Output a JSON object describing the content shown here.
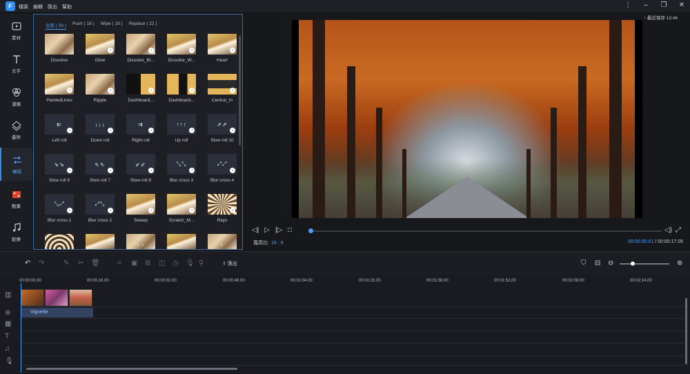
{
  "app": {
    "logo": "F",
    "menu": [
      "檔案",
      "編輯",
      "匯出",
      "幫助"
    ]
  },
  "window_controls": [
    "more-vertical",
    "minimize",
    "restore",
    "close"
  ],
  "rail": [
    {
      "label": "素材",
      "icon": "media-icon"
    },
    {
      "label": "文字",
      "icon": "text-icon"
    },
    {
      "label": "濾鏡",
      "icon": "filter-icon"
    },
    {
      "label": "疊附",
      "icon": "overlay-icon"
    },
    {
      "label": "轉場",
      "icon": "transition-icon",
      "active": true
    },
    {
      "label": "動畫",
      "icon": "animation-icon"
    },
    {
      "label": "配樂",
      "icon": "music-icon"
    }
  ],
  "panel": {
    "tabs": [
      "全部 ( 59 )",
      "Push ( 18 )",
      "Wipe ( 19 )",
      "Replace ( 22 )"
    ],
    "tiles": [
      [
        "Dissolve",
        "Glow",
        "Dissolve_Bl...",
        "Dissolve_W...",
        "Heart"
      ],
      [
        "PaintedLines",
        "Ripple",
        "Dashboard...",
        "Dashboard...",
        "Central_In"
      ],
      [
        "Left roll",
        "Down roll",
        "Right roll",
        "Up roll",
        "Slow roll 10"
      ],
      [
        "Slow roll 9",
        "Slow roll 7",
        "Slow roll 8",
        "Blur cross 3",
        "Blur cross 4"
      ],
      [
        "Blur cross 1",
        "Blur cross 2",
        "Sweep",
        "Scratch_M...",
        "Rays"
      ]
    ]
  },
  "preview": {
    "autosave": "最近保存 13:46",
    "ratio_label": "寬高比:",
    "ratio_value": "16 : 9",
    "current_time": "00:00:00.01",
    "separator": "/",
    "total_time": "00:00:17.05",
    "progress": 0.0
  },
  "toolbar": {
    "export_label": "匯出"
  },
  "timeline": {
    "ticks": [
      "00:00:00.00",
      "00:00:16.00",
      "00:00:32.00",
      "00:00:48.00",
      "00:01:04.00",
      "00:01:20.00",
      "00:01:36.00",
      "00:01:52.00",
      "00:02:08.00",
      "00:02:24.00"
    ],
    "effect_label": "Vignette"
  }
}
